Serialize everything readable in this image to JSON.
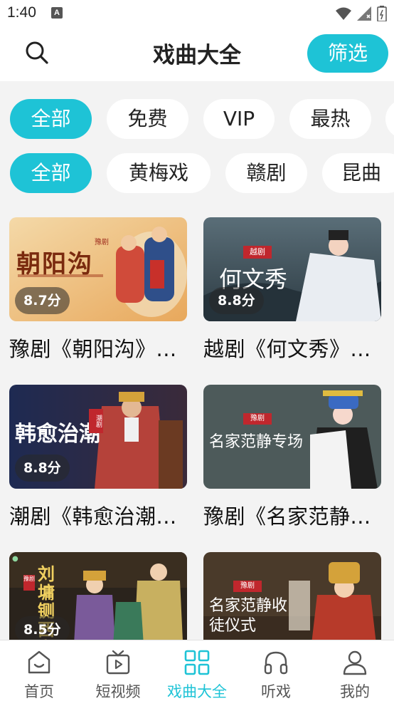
{
  "status_bar": {
    "time": "1:40",
    "notification_badge": "A"
  },
  "header": {
    "title": "戏曲大全",
    "filter_label": "筛选",
    "search_icon": "search-icon"
  },
  "price_filters": [
    {
      "label": "全部",
      "active": true
    },
    {
      "label": "免费",
      "active": false
    },
    {
      "label": "VIP",
      "active": false
    },
    {
      "label": "最热",
      "active": false
    }
  ],
  "genre_filters": [
    {
      "label": "全部",
      "active": true
    },
    {
      "label": "黄梅戏",
      "active": false
    },
    {
      "label": "赣剧",
      "active": false
    },
    {
      "label": "昆曲",
      "active": false
    }
  ],
  "cards": [
    {
      "title": "豫剧《朝阳沟》...",
      "score": "8.7分",
      "poster_text": "朝阳沟",
      "poster_tag": "豫剧"
    },
    {
      "title": "越剧《何文秀》...",
      "score": "8.8分",
      "poster_text": "何文秀",
      "poster_tag": "越剧"
    },
    {
      "title": "潮剧《韩愈治潮...",
      "score": "8.8分",
      "poster_text": "韩愈治潮",
      "poster_tag": "潮剧"
    },
    {
      "title": "豫剧《名家范静...",
      "score": "",
      "poster_text": "名家范静专场",
      "poster_tag": "豫剧"
    },
    {
      "title": "",
      "score": "8.5分",
      "poster_text": "刘墉铡西宫",
      "poster_tag": "豫剧"
    },
    {
      "title": "",
      "score": "",
      "poster_text": "名家范静收徒仪式",
      "poster_tag": "豫剧"
    }
  ],
  "tabbar": [
    {
      "label": "首页",
      "icon": "home-icon",
      "active": false
    },
    {
      "label": "短视频",
      "icon": "video-icon",
      "active": false
    },
    {
      "label": "戏曲大全",
      "icon": "grid-icon",
      "active": true
    },
    {
      "label": "听戏",
      "icon": "headphones-icon",
      "active": false
    },
    {
      "label": "我的",
      "icon": "user-icon",
      "active": false
    }
  ],
  "colors": {
    "accent": "#1ec3d6",
    "background": "#f3f3f3"
  }
}
